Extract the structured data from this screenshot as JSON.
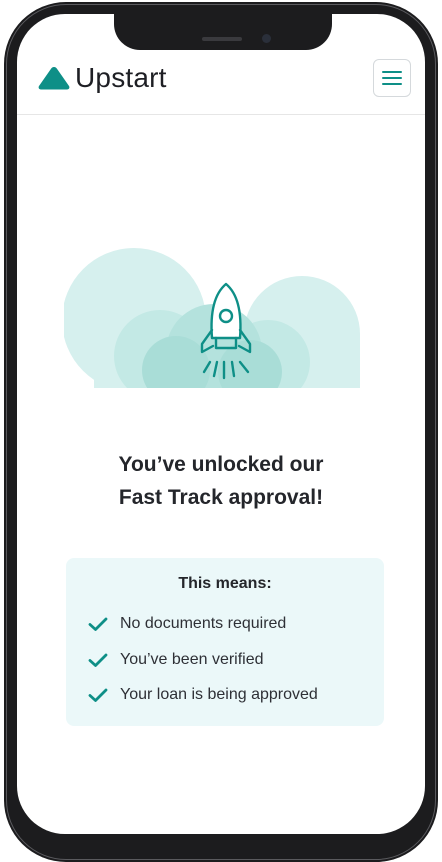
{
  "header": {
    "brand": "Upstart",
    "logo_icon": "upstart-logo-icon",
    "menu_icon": "hamburger-menu-icon"
  },
  "illustration": {
    "icon": "rocket-icon"
  },
  "heading": {
    "line1": "You’ve unlocked our",
    "line2": "Fast Track approval!"
  },
  "info": {
    "title": "This means:",
    "items": [
      {
        "label": "No documents required",
        "icon": "check-icon"
      },
      {
        "label": "You’ve been verified",
        "icon": "check-icon"
      },
      {
        "label": "Your loan is being approved",
        "icon": "check-icon"
      }
    ]
  },
  "colors": {
    "accent": "#0e8f87",
    "cloud_light": "#d6f0ee",
    "cloud_mid": "#b8e4e0",
    "info_bg": "#ebf8f9",
    "text": "#24262b"
  }
}
